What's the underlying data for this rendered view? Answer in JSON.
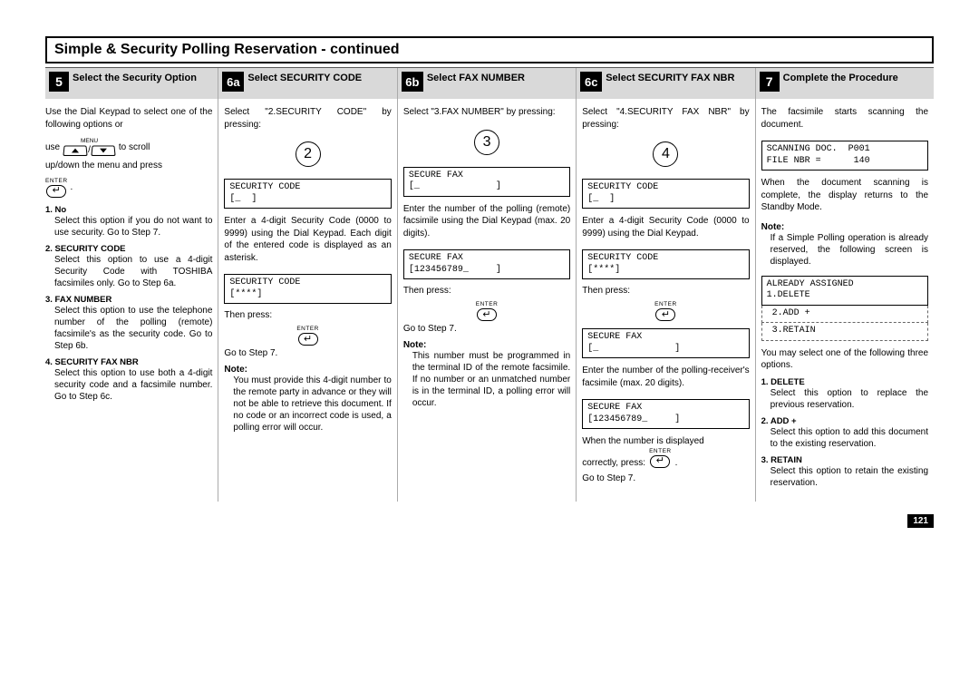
{
  "page_title": "Simple & Security Polling Reservation - continued",
  "page_number": "121",
  "col5": {
    "step_num": "5",
    "title": "Select the Security Option",
    "intro": "Use the Dial Keypad to select one of the following options or",
    "use_word": "use",
    "to_scroll": "to scroll",
    "menu_lbl": "MENU",
    "enter_lbl": "ENTER",
    "after_scroll": "up/down the menu and press",
    "opt1_head": "1. No",
    "opt1_body": "Select this option if you do not want to use security. Go to Step 7.",
    "opt2_head": "2. SECURITY CODE",
    "opt2_body": "Select this option to use a 4-digit Security Code with TOSHIBA facsimiles only. Go to Step 6a.",
    "opt3_head": "3. FAX NUMBER",
    "opt3_body": "Select this option to use the telephone number of the polling (remote) facsimile's as the security code. Go to Step 6b.",
    "opt4_head": "4. SECURITY FAX NBR",
    "opt4_body": "Select this option to use both a 4-digit security code and a facsimile number. Go to Step 6c."
  },
  "col6a": {
    "step_num": "6a",
    "title": "Select SECURITY CODE",
    "intro": "Select \"2.SECURITY CODE\" by pressing:",
    "circle": "2",
    "lcd1": "SECURITY CODE\n[_  ]",
    "para1": "Enter a 4-digit Security Code (0000 to 9999) using the Dial Keypad. Each digit of the entered code is displayed as an asterisk.",
    "lcd2": "SECURITY CODE\n[****]",
    "then_press": "Then press:",
    "enter_lbl": "ENTER",
    "goto": "Go to Step 7.",
    "note_head": "Note:",
    "note_body": "You must provide this 4-digit number to the remote party in advance or they will not be able to retrieve this document. If no code or an incorrect code is used, a polling error will occur."
  },
  "col6b": {
    "step_num": "6b",
    "title": "Select FAX NUMBER",
    "intro": "Select \"3.FAX NUMBER\" by pressing:",
    "circle": "3",
    "lcd1": "SECURE FAX\n[_              ]",
    "para1": "Enter the number of the polling (remote) facsimile using the Dial Keypad (max. 20 digits).",
    "lcd2": "SECURE FAX\n[123456789_     ]",
    "then_press": "Then press:",
    "enter_lbl": "ENTER",
    "goto": "Go to Step 7.",
    "note_head": "Note:",
    "note_body": "This number must be programmed in the terminal ID of the remote facsimile. If no number or an unmatched number is in the terminal ID, a polling error will occur."
  },
  "col6c": {
    "step_num": "6c",
    "title": "Select SECURITY FAX NBR",
    "intro": "Select \"4.SECURITY FAX NBR\" by pressing:",
    "circle": "4",
    "lcd1": "SECURITY CODE\n[_  ]",
    "para1": "Enter a 4-digit Security Code (0000 to 9999) using the Dial Keypad.",
    "lcd2": "SECURITY CODE\n[****]",
    "then_press": "Then press:",
    "enter_lbl": "ENTER",
    "lcd3": "SECURE FAX\n[_              ]",
    "para2": "Enter the number of the polling-receiver's facsimile (max. 20 digits).",
    "lcd4": "SECURE FAX\n[123456789_     ]",
    "para3a": "When the number is displayed",
    "para3b": "correctly, press:",
    "goto": "Go to Step 7."
  },
  "col7": {
    "step_num": "7",
    "title": "Complete the Procedure",
    "intro": "The facsimile starts scanning the document.",
    "lcd1": "SCANNING DOC.  P001\nFILE NBR =      140",
    "para1": "When the document scanning is complete, the display returns to the Standby Mode.",
    "note_head": "Note:",
    "note_body": "If a Simple Polling operation is already reserved, the following screen is displayed.",
    "lcd2": "ALREADY ASSIGNED\n1.DELETE",
    "lcd2b": " 2.ADD +",
    "lcd2c": " 3.RETAIN",
    "para2": "You may select one of the following three options.",
    "opt1_head": "1. DELETE",
    "opt1_body": "Select this option to replace the previous reservation.",
    "opt2_head": "2. ADD +",
    "opt2_body": "Select this option to add this document to the existing reservation.",
    "opt3_head": "3. RETAIN",
    "opt3_body": "Select this option to retain the existing reservation."
  }
}
